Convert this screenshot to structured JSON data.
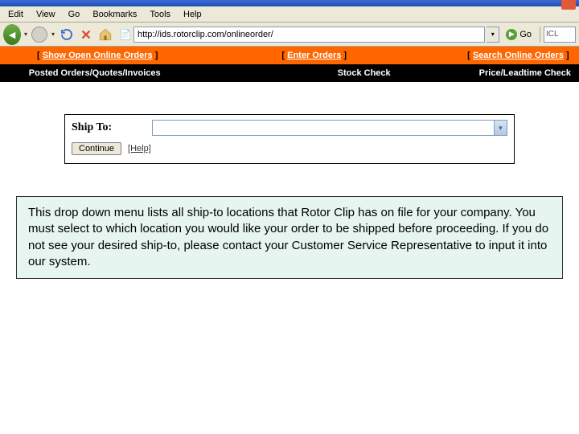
{
  "menu": {
    "edit": "Edit",
    "view": "View",
    "go": "Go",
    "bookmarks": "Bookmarks",
    "tools": "Tools",
    "help": "Help"
  },
  "address": {
    "url": "http://ids.rotorclip.com/onlineorder/",
    "go": "Go",
    "search_placeholder": "ICL"
  },
  "orange_nav": {
    "show_orders": "Show Open Online Orders",
    "enter_orders": "Enter Orders",
    "search_orders": "Search Online Orders"
  },
  "black_nav": {
    "posted": "Posted Orders/Quotes/Invoices",
    "stock": "Stock Check",
    "price": "Price/Leadtime Check"
  },
  "form": {
    "shipto_label": "Ship To:",
    "continue": "Continue",
    "help": "[Help]"
  },
  "instruction": "This drop down menu lists all ship-to locations that Rotor Clip has on file for your company.  You must select to which location you would like your order to be shipped before proceeding.  If you do not see your desired ship-to, please contact your Customer Service Representative to input it into our system."
}
